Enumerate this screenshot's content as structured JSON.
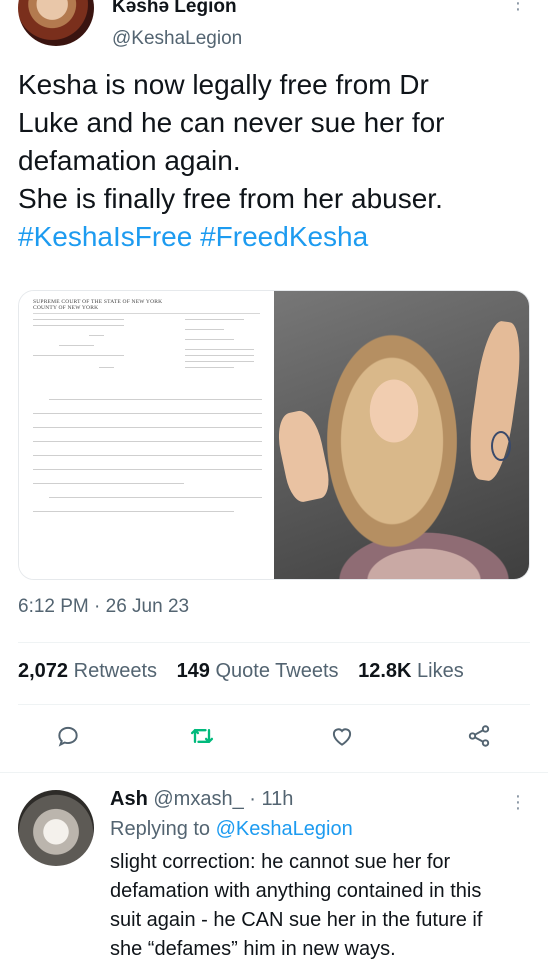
{
  "tweet": {
    "author_name": "Kəshə Legion",
    "author_handle": "@KeshaLegion",
    "text_lines": [
      "Kesha is now legally free from Dr",
      "Luke and he can never sue her for",
      "defamation again.",
      "She is finally free from her abuser."
    ],
    "hashtags": "#KeshaIsFree #FreedKesha",
    "document": {
      "court_header": "SUPREME COURT OF THE STATE OF NEW YORK COUNTY OF NEW YORK"
    },
    "timestamp": "6:12 PM · 26 Jun 23",
    "stats": {
      "retweets_count": "2,072",
      "retweets_label": "Retweets",
      "quotes_count": "149",
      "quotes_label": "Quote Tweets",
      "likes_count": "12.8K",
      "likes_label": "Likes"
    }
  },
  "reply": {
    "author_name": "Ash",
    "author_handle": "@mxash_",
    "time": "· 11h",
    "replying_prefix": "Replying to",
    "replying_to": "@KeshaLegion",
    "text_lines": [
      "slight correction: he cannot sue her for",
      "defamation with anything contained in this",
      "suit again - he CAN sue her in the future if",
      "she “defames” him in new ways."
    ]
  },
  "icons": [
    "more-icon",
    "reply-icon",
    "retweet-icon",
    "like-icon",
    "share-icon"
  ],
  "colors": {
    "accent": "#1d9bf0",
    "secondary_text": "#536471",
    "retweet_green": "#00ba7c"
  }
}
